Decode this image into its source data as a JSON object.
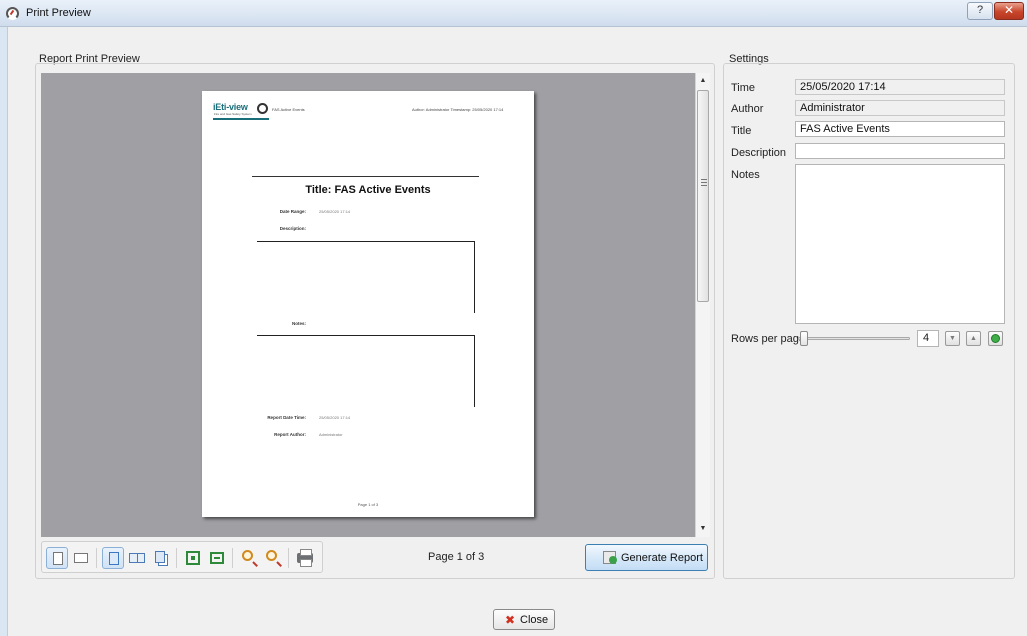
{
  "window": {
    "title": "Print Preview",
    "help_label": "?",
    "close_label": "✕"
  },
  "preview": {
    "group_title": "Report Print Preview",
    "page": {
      "logo_text": "iEti-view",
      "logo_sub": "Fire and Gas Safety System",
      "header_left": "FAS Active Events",
      "header_right": "Author: Administrator   Timestamp: 25/05/2020 17:14",
      "title_line": "Title:  FAS Active Events",
      "date_range_label": "Date Range:",
      "date_range_value": "25/05/2020 17:14",
      "description_label": "Description:",
      "notes_label": "Notes:",
      "report_datetime_label": "Report Date Time:",
      "report_datetime_value": "25/05/2020 17:14",
      "report_author_label": "Report Author:",
      "report_author_value": "Administrator",
      "footer": "Page 1 of 3"
    },
    "page_indicator": "Page 1 of 3",
    "generate_label": "Generate Report",
    "toolbar_icons": [
      "fit-page-icon",
      "fit-width-icon",
      "single-page-icon",
      "facing-pages-icon",
      "all-pages-icon",
      "fit-to-window-icon",
      "actual-size-icon",
      "zoom-in-icon",
      "zoom-out-icon",
      "print-icon"
    ]
  },
  "settings": {
    "group_title": "Settings",
    "time_label": "Time",
    "time_value": "25/05/2020 17:14",
    "author_label": "Author",
    "author_value": "Administrator",
    "title_label": "Title",
    "title_value": "FAS Active Events",
    "description_label": "Description",
    "description_value": "",
    "notes_label": "Notes",
    "notes_value": "",
    "rows_label": "Rows per page",
    "rows_value": "4",
    "rows_slider_position": 0.0
  },
  "footer": {
    "close_label": "Close"
  },
  "colors": {
    "accent": "#3c7fb1",
    "preview_background": "#a0a0a4",
    "close_red": "#d32f1f"
  }
}
